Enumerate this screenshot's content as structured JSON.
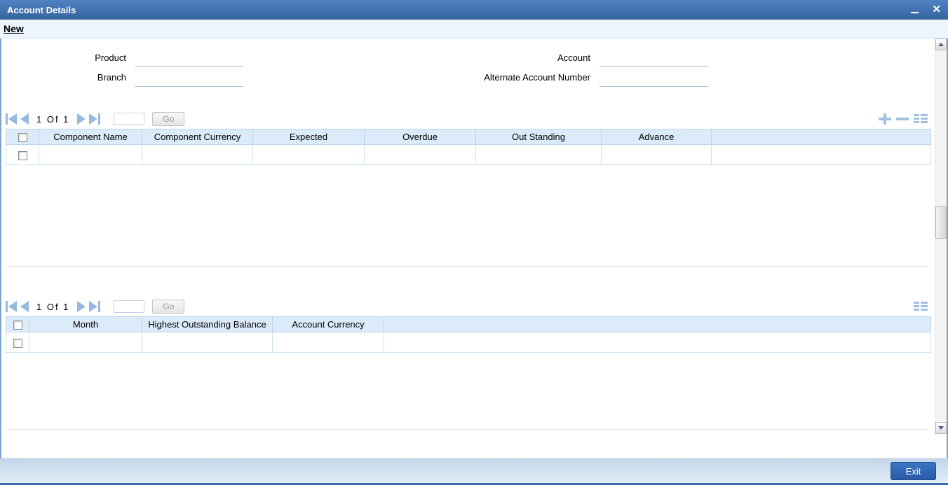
{
  "window": {
    "title": "Account Details"
  },
  "menubar": {
    "new_label": "New"
  },
  "icons": {
    "minimize": "minimize-bar",
    "close": "✕",
    "first_page": "left-triangle-with-bar",
    "previous_page": "left-triangle",
    "next_page": "right-triangle",
    "last_page": "right-triangle-with-bar",
    "add_row": "plus",
    "delete_row": "minus",
    "details": "list-grid"
  },
  "form": {
    "product_label": "Product",
    "product_value": "",
    "branch_label": "Branch",
    "branch_value": "",
    "account_label": "Account",
    "account_value": "",
    "alternate_label": "Alternate Account Number",
    "alternate_value": ""
  },
  "components": {
    "pagination": {
      "page_text": "1 Of 1",
      "page_value": "",
      "go_label": "Go"
    },
    "columns": [
      "Component Name",
      "Component Currency",
      "Expected",
      "Overdue",
      "Out Standing",
      "Advance"
    ],
    "row": [
      "",
      "",
      "",
      "",
      "",
      ""
    ]
  },
  "balances": {
    "pagination": {
      "page_text": "1 Of 1",
      "page_value": "",
      "go_label": "Go"
    },
    "columns": [
      "Month",
      "Highest Outstanding Balance",
      "Account Currency"
    ],
    "row": [
      "",
      "",
      ""
    ]
  },
  "footer": {
    "exit_label": "Exit"
  },
  "colors": {
    "titlebar": "#3e6db3",
    "accent_icon": "#9dbbe0",
    "table_header_bg": "#dcebf9",
    "table_border": "#ccdef2",
    "footer_bg": "#c3d7ea",
    "exit_button_bg": "#2d64b0"
  }
}
